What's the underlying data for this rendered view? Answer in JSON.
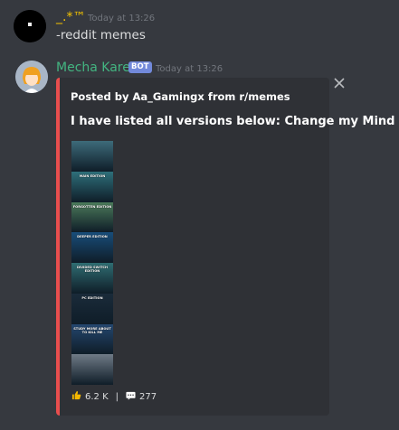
{
  "messages": [
    {
      "username": "_.*™",
      "username_color": "#f5c400",
      "timestamp": "Today at 13:26",
      "content": "-reddit memes"
    },
    {
      "username": "Mecha Karen",
      "username_color": "#43b581",
      "bot_badge": "BOT",
      "timestamp": "Today at 13:26"
    }
  ],
  "embed": {
    "accent_color": "#e84e4e",
    "author": "Posted by Aa_Gamingx from r/memes",
    "title": "I have listed all versions below: Change my Mind",
    "close_icon": "close-icon",
    "image_panels": [
      {
        "label": "",
        "color": "#3d6b7a"
      },
      {
        "label": "MAIN EDITION",
        "color": "#2e6f7a"
      },
      {
        "label": "FORGOTTEN EDITION",
        "color": "#4b7a5a"
      },
      {
        "label": "DEEPER EDITION",
        "color": "#184d7a"
      },
      {
        "label": "DIVIDED SWITCH EDITION",
        "color": "#2f6d72"
      },
      {
        "label": "PC EDITION",
        "color": "#1a2b3a"
      },
      {
        "label": "STUDY MORE ABOUT TO KILL ME",
        "color": "#24476f"
      },
      {
        "label": "",
        "color": "#6f7a86"
      }
    ],
    "upvotes": "6.2 K",
    "upvote_icon": "thumbs-up-icon",
    "comments": "277",
    "comment_icon": "comment-icon",
    "separator": "|"
  }
}
